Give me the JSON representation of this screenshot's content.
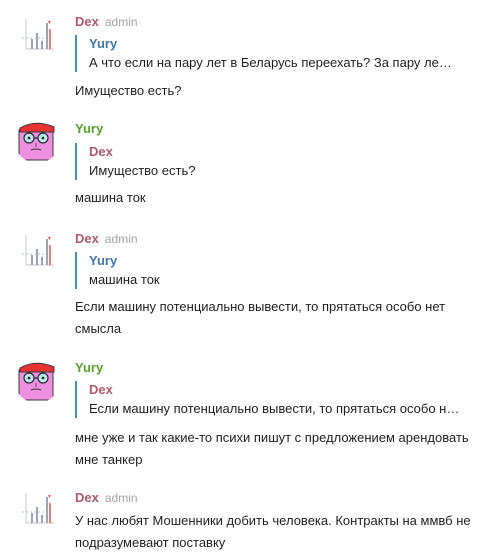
{
  "colors": {
    "dex_name": "#b1596f",
    "yury_name": "#5aa02a",
    "reply_bar": "#4a8ac3",
    "role_text": "#a3a3a3"
  },
  "messages": [
    {
      "author": "Dex",
      "role": "admin",
      "reply_author": "Yury",
      "reply_text": "А что если на пару лет в Беларусь переехать? За пару ле…",
      "text": "Имущество есть?"
    },
    {
      "author": "Yury",
      "role": "",
      "reply_author": "Dex",
      "reply_text": "Имущество есть?",
      "text": "машина ток"
    },
    {
      "author": "Dex",
      "role": "admin",
      "reply_author": "Yury",
      "reply_text": "машина ток",
      "text": "Если машину потенциально вывести, то прятаться особо нет смысла"
    },
    {
      "author": "Yury",
      "role": "",
      "reply_author": "Dex",
      "reply_text": "Если машину потенциально вывести, то прятаться особо н…",
      "text": "мне уже и так какие-то психи пишут с предложением арендовать мне танкер"
    },
    {
      "author": "Dex",
      "role": "admin",
      "reply_author": "",
      "reply_text": "",
      "text": "У нас любят Мошенники добить человека. Контракты на ммвб не подразумевают поставку"
    }
  ]
}
